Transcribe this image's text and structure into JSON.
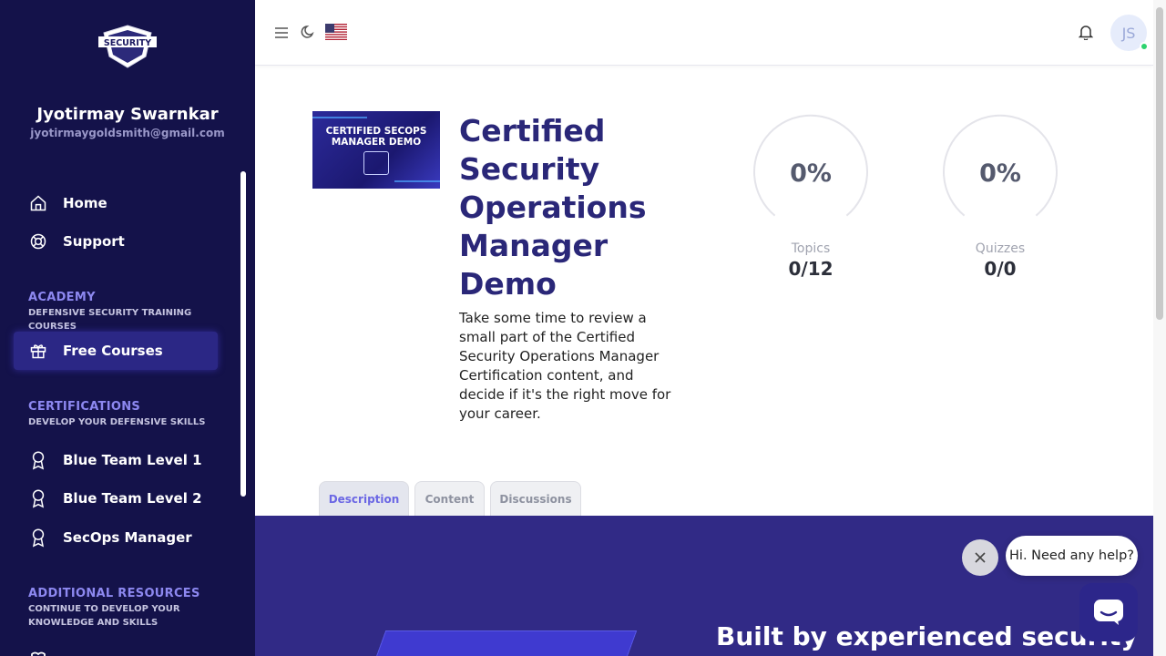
{
  "sidebar": {
    "logo_text": "SECURITY",
    "user": {
      "name": "Jyotirmay Swarnkar",
      "email": "jyotirmaygoldsmith@gmail.com"
    },
    "items": [
      {
        "label": "Home",
        "icon": "home-icon"
      },
      {
        "label": "Support",
        "icon": "lifebuoy-icon"
      }
    ],
    "sections": [
      {
        "title": "ACADEMY",
        "subtitle": "DEFENSIVE SECURITY TRAINING COURSES",
        "items": [
          {
            "label": "Free Courses",
            "icon": "gift-icon",
            "active": true
          }
        ]
      },
      {
        "title": "CERTIFICATIONS",
        "subtitle": "DEVELOP YOUR DEFENSIVE SKILLS",
        "items": [
          {
            "label": "Blue Team Level 1",
            "icon": "award-icon"
          },
          {
            "label": "Blue Team Level 2",
            "icon": "award-icon"
          },
          {
            "label": "SecOps Manager",
            "icon": "award-icon"
          }
        ]
      },
      {
        "title": "ADDITIONAL RESOURCES",
        "subtitle": "CONTINUE TO DEVELOP YOUR KNOWLEDGE AND SKILLS"
      }
    ]
  },
  "topbar": {
    "avatar_initials": "JS"
  },
  "course": {
    "thumb_title": "CERTIFIED SECOPS MANAGER DEMO",
    "title": "Certified Security Operations Manager Demo",
    "description": "Take some time to review a small part of the Certified Security Operations Manager Certification content, and decide if it's the right move for your career."
  },
  "progress": [
    {
      "label": "Topics",
      "percent": "0%",
      "value": "0/12"
    },
    {
      "label": "Quizzes",
      "percent": "0%",
      "value": "0/0"
    }
  ],
  "tabs": [
    {
      "label": "Description",
      "active": true
    },
    {
      "label": "Content"
    },
    {
      "label": "Discussions"
    }
  ],
  "banner": {
    "heading": "Built by experienced security"
  },
  "chat": {
    "greeting": "Hi. Need any help?"
  }
}
